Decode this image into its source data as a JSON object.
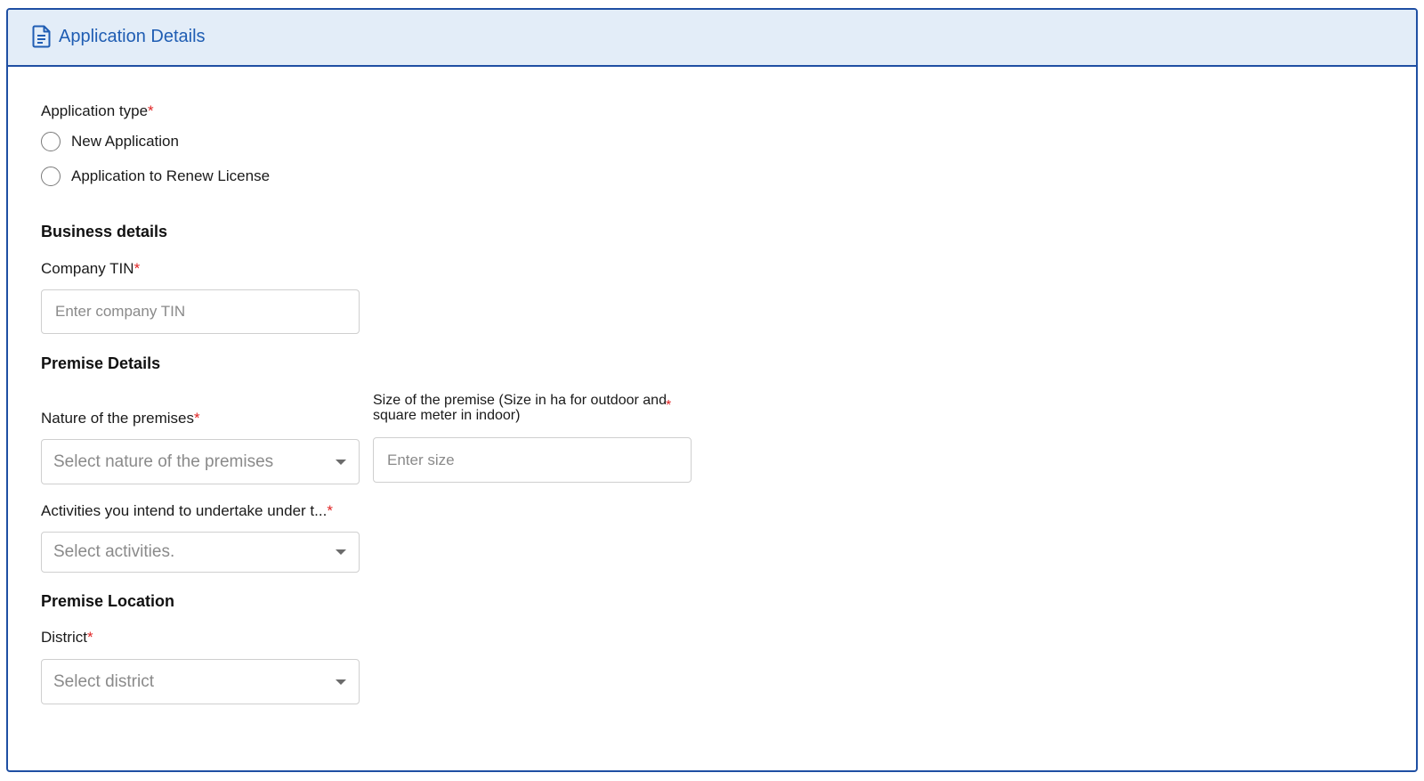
{
  "header": {
    "icon": "document-icon",
    "title": "Application Details"
  },
  "application_type": {
    "label": "Application type",
    "required_mark": "*",
    "options": [
      {
        "label": "New Application",
        "selected": false
      },
      {
        "label": "Application to Renew License",
        "selected": false
      }
    ]
  },
  "business_details": {
    "title": "Business details",
    "company_tin": {
      "label": "Company TIN",
      "required_mark": "*",
      "placeholder": "Enter company TIN",
      "value": ""
    }
  },
  "premise_details": {
    "title": "Premise Details",
    "nature": {
      "label": "Nature of the premises",
      "required_mark": "*",
      "placeholder": "Select nature of the premises"
    },
    "size": {
      "label": "Size of the premise (Size in ha for outdoor and square meter in indoor)",
      "required_mark": "*",
      "placeholder": "Enter size",
      "value": ""
    },
    "activities": {
      "label": "Activities you intend to undertake under t...",
      "required_mark": "*",
      "placeholder": "Select activities."
    }
  },
  "premise_location": {
    "title": "Premise Location",
    "district": {
      "label": "District",
      "required_mark": "*",
      "placeholder": "Select district"
    }
  },
  "colors": {
    "accent": "#1f4fa3",
    "header_bg": "#e3edf8",
    "required": "#e02424"
  }
}
